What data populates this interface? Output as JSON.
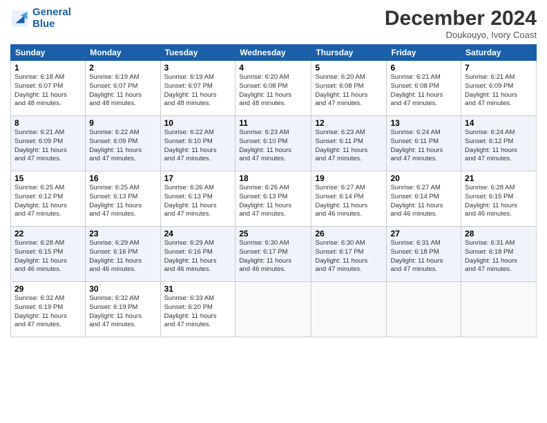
{
  "header": {
    "logo_line1": "General",
    "logo_line2": "Blue",
    "month": "December 2024",
    "location": "Doukouyo, Ivory Coast"
  },
  "weekdays": [
    "Sunday",
    "Monday",
    "Tuesday",
    "Wednesday",
    "Thursday",
    "Friday",
    "Saturday"
  ],
  "weeks": [
    [
      {
        "day": "1",
        "info": "Sunrise: 6:18 AM\nSunset: 6:07 PM\nDaylight: 11 hours\nand 48 minutes."
      },
      {
        "day": "2",
        "info": "Sunrise: 6:19 AM\nSunset: 6:07 PM\nDaylight: 11 hours\nand 48 minutes."
      },
      {
        "day": "3",
        "info": "Sunrise: 6:19 AM\nSunset: 6:07 PM\nDaylight: 11 hours\nand 48 minutes."
      },
      {
        "day": "4",
        "info": "Sunrise: 6:20 AM\nSunset: 6:08 PM\nDaylight: 11 hours\nand 48 minutes."
      },
      {
        "day": "5",
        "info": "Sunrise: 6:20 AM\nSunset: 6:08 PM\nDaylight: 11 hours\nand 47 minutes."
      },
      {
        "day": "6",
        "info": "Sunrise: 6:21 AM\nSunset: 6:08 PM\nDaylight: 11 hours\nand 47 minutes."
      },
      {
        "day": "7",
        "info": "Sunrise: 6:21 AM\nSunset: 6:09 PM\nDaylight: 11 hours\nand 47 minutes."
      }
    ],
    [
      {
        "day": "8",
        "info": "Sunrise: 6:21 AM\nSunset: 6:09 PM\nDaylight: 11 hours\nand 47 minutes."
      },
      {
        "day": "9",
        "info": "Sunrise: 6:22 AM\nSunset: 6:09 PM\nDaylight: 11 hours\nand 47 minutes."
      },
      {
        "day": "10",
        "info": "Sunrise: 6:22 AM\nSunset: 6:10 PM\nDaylight: 11 hours\nand 47 minutes."
      },
      {
        "day": "11",
        "info": "Sunrise: 6:23 AM\nSunset: 6:10 PM\nDaylight: 11 hours\nand 47 minutes."
      },
      {
        "day": "12",
        "info": "Sunrise: 6:23 AM\nSunset: 6:11 PM\nDaylight: 11 hours\nand 47 minutes."
      },
      {
        "day": "13",
        "info": "Sunrise: 6:24 AM\nSunset: 6:11 PM\nDaylight: 11 hours\nand 47 minutes."
      },
      {
        "day": "14",
        "info": "Sunrise: 6:24 AM\nSunset: 6:12 PM\nDaylight: 11 hours\nand 47 minutes."
      }
    ],
    [
      {
        "day": "15",
        "info": "Sunrise: 6:25 AM\nSunset: 6:12 PM\nDaylight: 11 hours\nand 47 minutes."
      },
      {
        "day": "16",
        "info": "Sunrise: 6:25 AM\nSunset: 6:13 PM\nDaylight: 11 hours\nand 47 minutes."
      },
      {
        "day": "17",
        "info": "Sunrise: 6:26 AM\nSunset: 6:13 PM\nDaylight: 11 hours\nand 47 minutes."
      },
      {
        "day": "18",
        "info": "Sunrise: 6:26 AM\nSunset: 6:13 PM\nDaylight: 11 hours\nand 47 minutes."
      },
      {
        "day": "19",
        "info": "Sunrise: 6:27 AM\nSunset: 6:14 PM\nDaylight: 11 hours\nand 46 minutes."
      },
      {
        "day": "20",
        "info": "Sunrise: 6:27 AM\nSunset: 6:14 PM\nDaylight: 11 hours\nand 46 minutes."
      },
      {
        "day": "21",
        "info": "Sunrise: 6:28 AM\nSunset: 6:15 PM\nDaylight: 11 hours\nand 46 minutes."
      }
    ],
    [
      {
        "day": "22",
        "info": "Sunrise: 6:28 AM\nSunset: 6:15 PM\nDaylight: 11 hours\nand 46 minutes."
      },
      {
        "day": "23",
        "info": "Sunrise: 6:29 AM\nSunset: 6:16 PM\nDaylight: 11 hours\nand 46 minutes."
      },
      {
        "day": "24",
        "info": "Sunrise: 6:29 AM\nSunset: 6:16 PM\nDaylight: 11 hours\nand 46 minutes."
      },
      {
        "day": "25",
        "info": "Sunrise: 6:30 AM\nSunset: 6:17 PM\nDaylight: 11 hours\nand 46 minutes."
      },
      {
        "day": "26",
        "info": "Sunrise: 6:30 AM\nSunset: 6:17 PM\nDaylight: 11 hours\nand 47 minutes."
      },
      {
        "day": "27",
        "info": "Sunrise: 6:31 AM\nSunset: 6:18 PM\nDaylight: 11 hours\nand 47 minutes."
      },
      {
        "day": "28",
        "info": "Sunrise: 6:31 AM\nSunset: 6:18 PM\nDaylight: 11 hours\nand 47 minutes."
      }
    ],
    [
      {
        "day": "29",
        "info": "Sunrise: 6:32 AM\nSunset: 6:19 PM\nDaylight: 11 hours\nand 47 minutes."
      },
      {
        "day": "30",
        "info": "Sunrise: 6:32 AM\nSunset: 6:19 PM\nDaylight: 11 hours\nand 47 minutes."
      },
      {
        "day": "31",
        "info": "Sunrise: 6:33 AM\nSunset: 6:20 PM\nDaylight: 11 hours\nand 47 minutes."
      },
      null,
      null,
      null,
      null
    ]
  ]
}
